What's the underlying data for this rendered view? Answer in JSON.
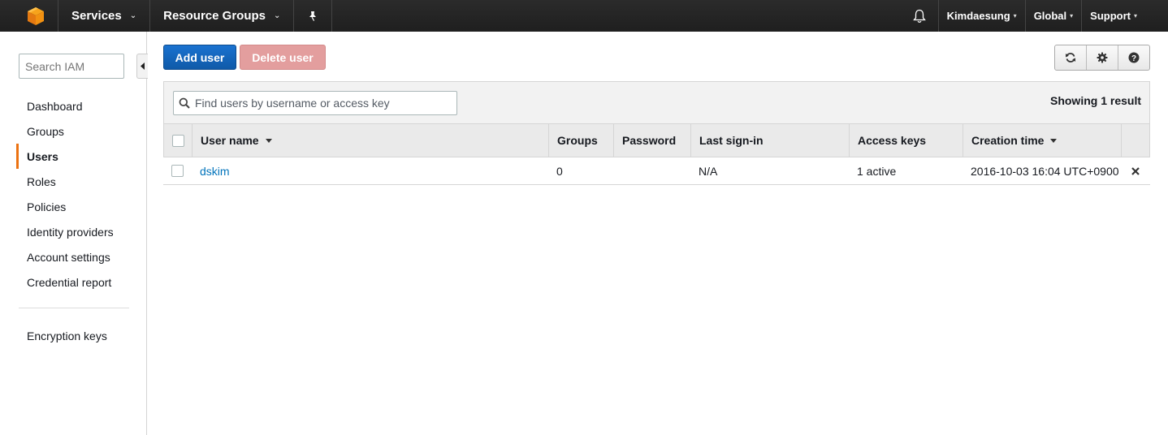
{
  "topbar": {
    "logo_icon": "aws-cube-icon",
    "services_label": "Services",
    "resource_groups_label": "Resource Groups",
    "pin_icon": "pin-icon",
    "bell_icon": "bell-icon",
    "account_label": "Kimdaesung",
    "region_label": "Global",
    "support_label": "Support",
    "accent_color": "#ff9900"
  },
  "sidebar": {
    "search_placeholder": "Search IAM",
    "collapse_icon": "caret-left-icon",
    "items": [
      {
        "label": "Dashboard",
        "active": false
      },
      {
        "label": "Groups",
        "active": false
      },
      {
        "label": "Users",
        "active": true
      },
      {
        "label": "Roles",
        "active": false
      },
      {
        "label": "Policies",
        "active": false
      },
      {
        "label": "Identity providers",
        "active": false
      },
      {
        "label": "Account settings",
        "active": false
      },
      {
        "label": "Credential report",
        "active": false
      }
    ],
    "encryption_label": "Encryption keys",
    "active_color": "#ec7211"
  },
  "toolbar": {
    "add_user_label": "Add user",
    "delete_user_label": "Delete user",
    "refresh_icon": "refresh-icon",
    "settings_icon": "gear-icon",
    "help_icon": "help-icon"
  },
  "table": {
    "search_placeholder": "Find users by username or access key",
    "showing_text": "Showing 1 result",
    "columns": [
      "User name",
      "Groups",
      "Password",
      "Last sign-in",
      "Access keys",
      "Creation time"
    ],
    "rows": [
      {
        "user_name": "dskim",
        "groups": "0",
        "password": "",
        "last_sign_in": "N/A",
        "access_keys": "1 active",
        "creation_time": "2016-10-03 16:04 UTC+0900"
      }
    ],
    "link_color": "#0073bb"
  }
}
